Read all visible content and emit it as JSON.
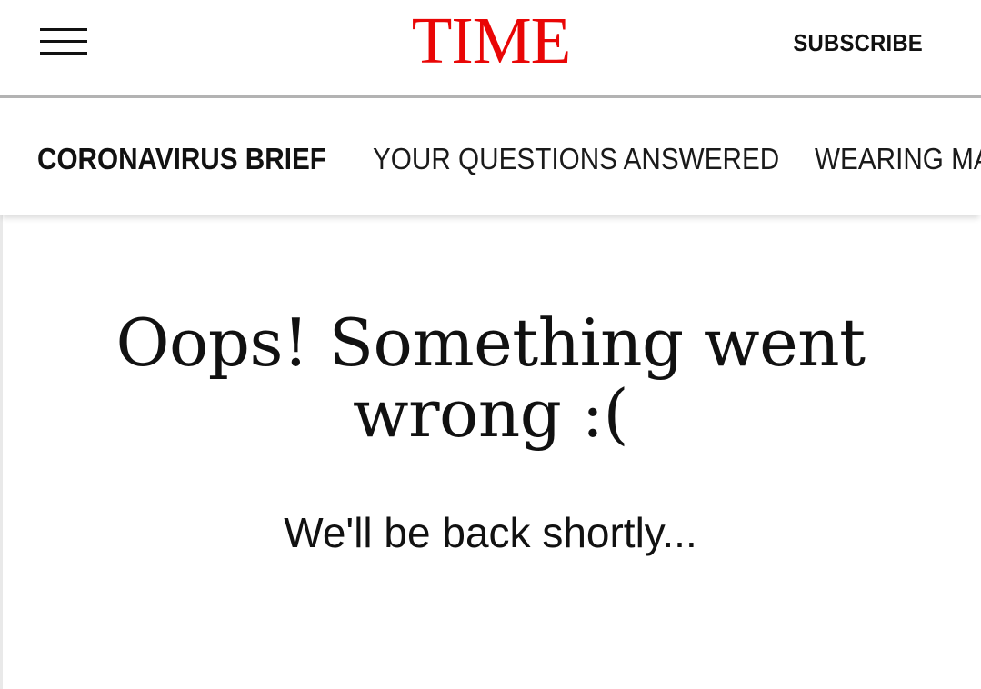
{
  "header": {
    "logo_text": "TIME",
    "logo_color": "#e90606",
    "menu_icon": "hamburger-menu-icon",
    "subscribe_label": "SUBSCRIBE"
  },
  "subnav": {
    "items": [
      {
        "label": "CORONAVIRUS BRIEF",
        "active": true
      },
      {
        "label": "YOUR QUESTIONS ANSWERED",
        "active": false
      },
      {
        "label": "WEARING MA",
        "active": false
      }
    ]
  },
  "error": {
    "title_line1": "Oops! Something went",
    "title_line2": "wrong :(",
    "message": "We'll be back shortly..."
  }
}
